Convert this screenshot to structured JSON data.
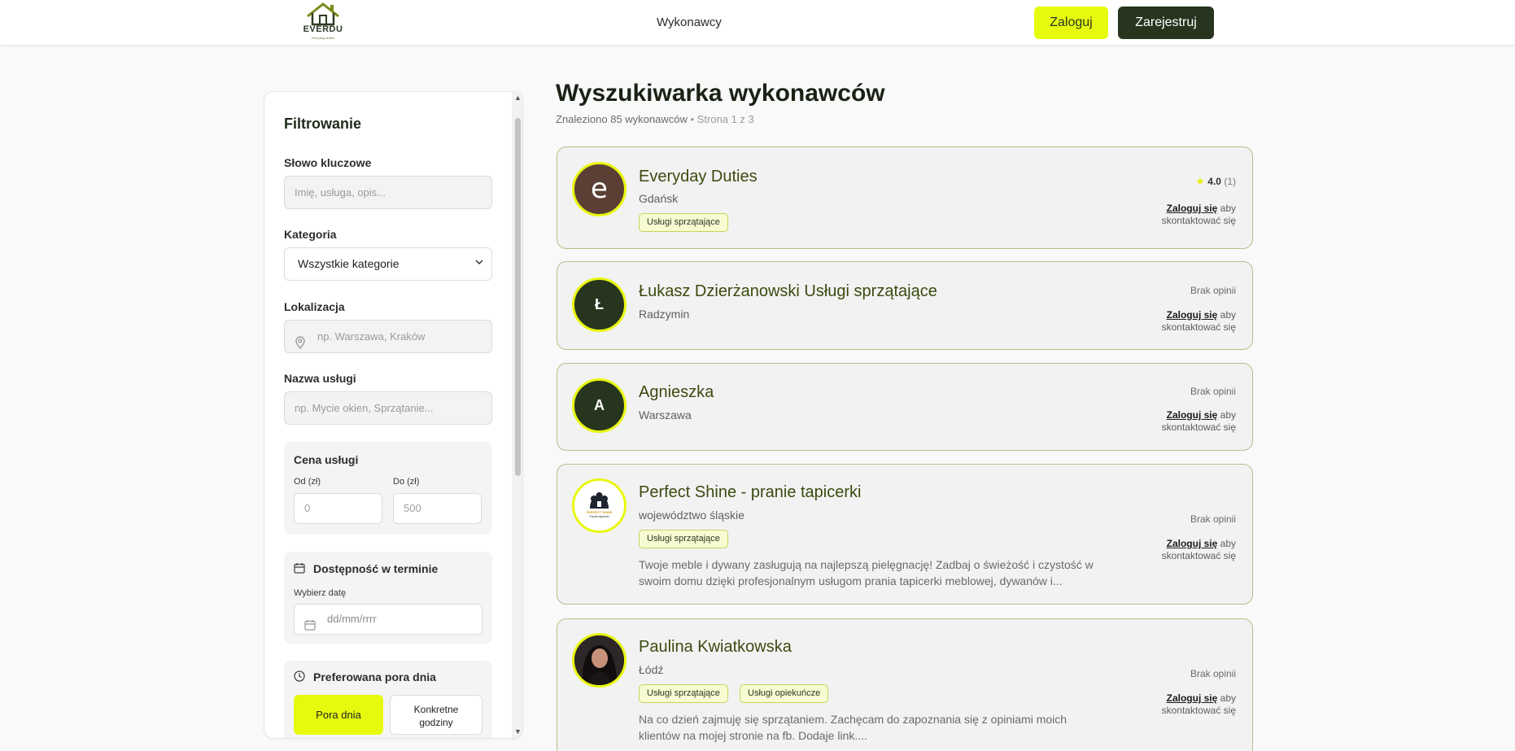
{
  "header": {
    "logo_text": "EVERDU",
    "logo_sub": "everyday duties",
    "nav_link": "Wykonawcy",
    "login_label": "Zaloguj",
    "register_label": "Zarejestruj"
  },
  "sidebar": {
    "title": "Filtrowanie",
    "keyword_label": "Słowo kluczowe",
    "keyword_placeholder": "Imię, usługa, opis...",
    "category_label": "Kategoria",
    "category_value": "Wszystkie kategorie",
    "location_label": "Lokalizacja",
    "location_placeholder": "np. Warszawa, Kraków",
    "service_label": "Nazwa usługi",
    "service_placeholder": "np. Mycie okien, Sprzątanie...",
    "price": {
      "title": "Cena usługi",
      "from_label": "Od (zł)",
      "from_placeholder": "0",
      "to_label": "Do (zł)",
      "to_placeholder": "500"
    },
    "availability": {
      "title": "Dostępność w terminie",
      "date_label": "Wybierz datę",
      "date_placeholder": "dd/mm/rrrr"
    },
    "time_of_day": {
      "title": "Preferowana pora dnia",
      "option_1": "Pora dnia",
      "option_2_line1": "Konkretne",
      "option_2_line2": "godziny"
    }
  },
  "main": {
    "title": "Wyszukiwarka wykonawców",
    "found": "Znaleziono 85 wykonawców",
    "page_info": "• Strona 1 z 3"
  },
  "cards": [
    {
      "initial": "e",
      "avatar_color": "#5b3f34",
      "name": "Everyday Duties",
      "city": "Gdańsk",
      "tags": [
        "Usługi sprzątające"
      ],
      "rating": "4.0",
      "rating_count": "(1)",
      "login_link": "Zaloguj się",
      "contact_rest_1": "aby",
      "contact_rest_2": "skontaktować się"
    },
    {
      "initial": "Ł",
      "avatar_color": "#27351f",
      "name": "Łukasz Dzierżanowski Usługi sprzątające",
      "city": "Radzymin",
      "no_review": "Brak opinii",
      "login_link": "Zaloguj się",
      "contact_rest_1": "aby",
      "contact_rest_2": "skontaktować się"
    },
    {
      "initial": "A",
      "avatar_color": "#27351f",
      "name": "Agnieszka",
      "city": "Warszawa",
      "no_review": "Brak opinii",
      "login_link": "Zaloguj się",
      "contact_rest_1": "aby",
      "contact_rest_2": "skontaktować się"
    },
    {
      "name": "Perfect Shine - pranie tapicerki",
      "city": "województwo śląskie",
      "tags": [
        "Usługi sprzątające"
      ],
      "desc": "Twoje meble i dywany zasługują na najlepszą pielęgnację! Zadbaj o świeżość i czystość w swoim domu dzięki profesjonalnym usługom prania tapicerki meblowej, dywanów i...",
      "no_review": "Brak opinii",
      "login_link": "Zaloguj się",
      "contact_rest_1": "aby",
      "contact_rest_2": "skontaktować się",
      "logo_text": "PERFECT SHINE",
      "logo_sub": "Pranie tapicerki"
    },
    {
      "name": "Paulina Kwiatkowska",
      "city": "Łódź",
      "tags": [
        "Usługi sprzątające",
        "Usługi opiekuńcze"
      ],
      "desc": "Na co dzień zajmuję się sprzątaniem. Zachęcam do zapoznania się z opiniami moich klientów na mojej stronie na fb. Dodaje link....",
      "no_review": "Brak opinii",
      "login_link": "Zaloguj się",
      "contact_rest_1": "aby",
      "contact_rest_2": "skontaktować się"
    }
  ],
  "colors": {
    "accent": "#e6fa0d",
    "dark": "#27351f",
    "name_green": "#3b4a0f",
    "card_border": "#b7bf88"
  }
}
